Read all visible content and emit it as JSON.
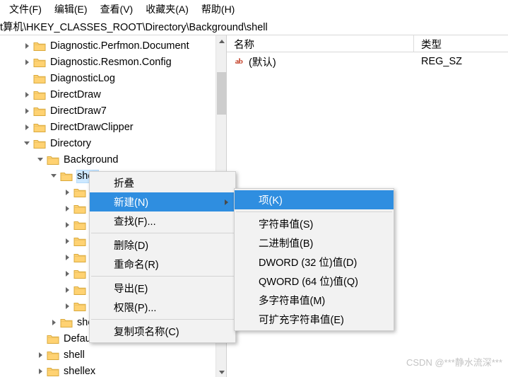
{
  "menubar": {
    "items": [
      {
        "label": "文件(F)"
      },
      {
        "label": "编辑(E)"
      },
      {
        "label": "查看(V)"
      },
      {
        "label": "收藏夹(A)"
      },
      {
        "label": "帮助(H)"
      }
    ]
  },
  "address": {
    "value": "t算机\\HKEY_CLASSES_ROOT\\Directory\\Background\\shell"
  },
  "tree": {
    "items": [
      {
        "label": "Diagnostic.Perfmon.Document",
        "indent": 1,
        "twist": "collapsed",
        "folder": true,
        "selected": false
      },
      {
        "label": "Diagnostic.Resmon.Config",
        "indent": 1,
        "twist": "collapsed",
        "folder": true,
        "selected": false
      },
      {
        "label": "DiagnosticLog",
        "indent": 1,
        "twist": "none",
        "folder": true,
        "selected": false
      },
      {
        "label": "DirectDraw",
        "indent": 1,
        "twist": "collapsed",
        "folder": true,
        "selected": false
      },
      {
        "label": "DirectDraw7",
        "indent": 1,
        "twist": "collapsed",
        "folder": true,
        "selected": false
      },
      {
        "label": "DirectDrawClipper",
        "indent": 1,
        "twist": "collapsed",
        "folder": true,
        "selected": false
      },
      {
        "label": "Directory",
        "indent": 1,
        "twist": "expanded",
        "folder": true,
        "selected": false
      },
      {
        "label": "Background",
        "indent": 2,
        "twist": "expanded",
        "folder": true,
        "selected": false
      },
      {
        "label": "shell",
        "indent": 3,
        "twist": "expanded",
        "folder": true,
        "selected": true
      },
      {
        "label": "",
        "indent": 4,
        "twist": "collapsed",
        "folder": true,
        "selected": false
      },
      {
        "label": "",
        "indent": 4,
        "twist": "collapsed",
        "folder": true,
        "selected": false
      },
      {
        "label": "",
        "indent": 4,
        "twist": "collapsed",
        "folder": true,
        "selected": false
      },
      {
        "label": "",
        "indent": 4,
        "twist": "collapsed",
        "folder": true,
        "selected": false
      },
      {
        "label": "",
        "indent": 4,
        "twist": "collapsed",
        "folder": true,
        "selected": false
      },
      {
        "label": "",
        "indent": 4,
        "twist": "collapsed",
        "folder": true,
        "selected": false
      },
      {
        "label": "",
        "indent": 4,
        "twist": "collapsed",
        "folder": true,
        "selected": false
      },
      {
        "label": "",
        "indent": 4,
        "twist": "collapsed",
        "folder": true,
        "selected": false
      },
      {
        "label": "shellex",
        "indent": 3,
        "twist": "collapsed",
        "folder": true,
        "selected": false
      },
      {
        "label": "DefaultIcon",
        "indent": 2,
        "twist": "none",
        "folder": true,
        "selected": false
      },
      {
        "label": "shell",
        "indent": 2,
        "twist": "collapsed",
        "folder": true,
        "selected": false
      },
      {
        "label": "shellex",
        "indent": 2,
        "twist": "collapsed",
        "folder": true,
        "selected": false
      }
    ]
  },
  "listview": {
    "columns": [
      {
        "label": "名称"
      },
      {
        "label": "类型"
      }
    ],
    "rows": [
      {
        "icon": "ab-string-icon",
        "name": "(默认)",
        "type": "REG_SZ"
      }
    ]
  },
  "context_menu": {
    "items": [
      {
        "label": "折叠",
        "type": "item"
      },
      {
        "label": "新建(N)",
        "type": "submenu",
        "selected": true
      },
      {
        "label": "查找(F)...",
        "type": "item"
      },
      {
        "type": "separator"
      },
      {
        "label": "删除(D)",
        "type": "item"
      },
      {
        "label": "重命名(R)",
        "type": "item"
      },
      {
        "type": "separator"
      },
      {
        "label": "导出(E)",
        "type": "item"
      },
      {
        "label": "权限(P)...",
        "type": "item"
      },
      {
        "type": "separator"
      },
      {
        "label": "复制项名称(C)",
        "type": "item"
      }
    ]
  },
  "submenu": {
    "items": [
      {
        "label": "项(K)",
        "selected": true
      },
      {
        "type": "separator"
      },
      {
        "label": "字符串值(S)",
        "selected": false
      },
      {
        "label": "二进制值(B)",
        "selected": false
      },
      {
        "label": "DWORD (32 位)值(D)",
        "selected": false
      },
      {
        "label": "QWORD (64 位)值(Q)",
        "selected": false
      },
      {
        "label": "多字符串值(M)",
        "selected": false
      },
      {
        "label": "可扩充字符串值(E)",
        "selected": false
      }
    ]
  },
  "watermark": {
    "text": "CSDN @***静水流深***"
  },
  "colors": {
    "menu_highlight": "#2f8ee0",
    "tree_selection": "#cde8ff",
    "folder": "#ffd272",
    "string_icon": "#c23b22"
  }
}
